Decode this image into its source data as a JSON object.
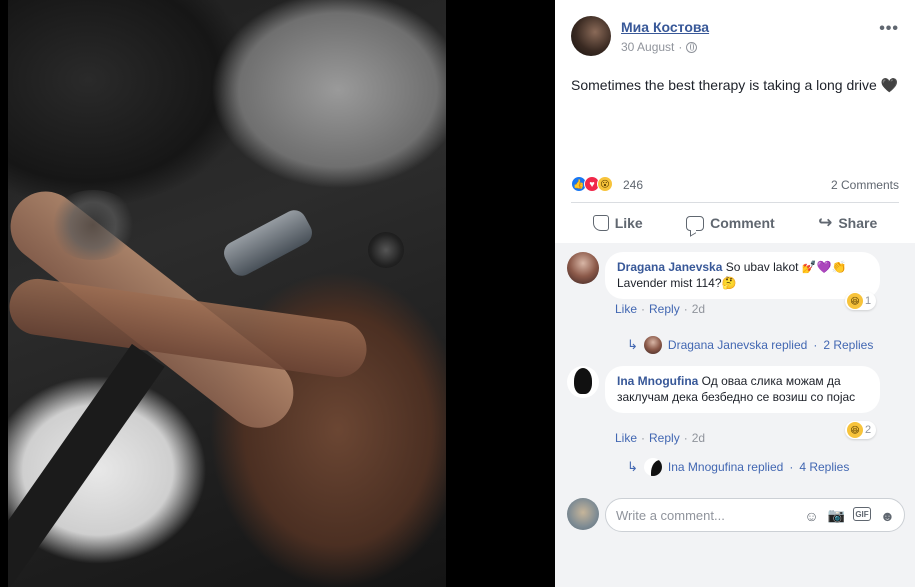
{
  "post": {
    "author": "Миа Костова",
    "date": "30 August",
    "date_sep": "·",
    "text": "Sometimes the best therapy is taking a long drive",
    "text_emoji": "🖤",
    "reaction_count": "246",
    "comments_count": "2 Comments"
  },
  "actions": {
    "like": "Like",
    "comment": "Comment",
    "share": "Share"
  },
  "comments": [
    {
      "name": "Dragana Janevska",
      "text": "So ubav lakot 💅💜👏 Lavender mist 114?🤔",
      "like": "Like",
      "reply": "Reply",
      "time": "2d",
      "haha_count": "1",
      "replied_text": "Dragana Janevska replied",
      "replies": "2 Replies"
    },
    {
      "name": "Ina Mnogufina",
      "text": "Од оваа слика можам да заклучам дека безбедно се возиш со појас",
      "like": "Like",
      "reply": "Reply",
      "time": "2d",
      "haha_count": "2",
      "replied_text": "Ina Mnogufina replied",
      "replies": "4 Replies"
    }
  ],
  "write": {
    "placeholder": "Write a comment..."
  },
  "icons": {
    "separator": "·",
    "more": "•••",
    "dots": "· ",
    "arrow": "↳",
    "share": "↪",
    "wow": "😮",
    "haha": "😆",
    "like": "👍",
    "love": "♥",
    "emoji": "☺",
    "camera": "📷",
    "gif": "GIF",
    "sticker": "☻"
  },
  "colors": {
    "link": "#385898",
    "accent": "#4267b2",
    "muted": "#90949c",
    "background": "#f2f3f5"
  }
}
